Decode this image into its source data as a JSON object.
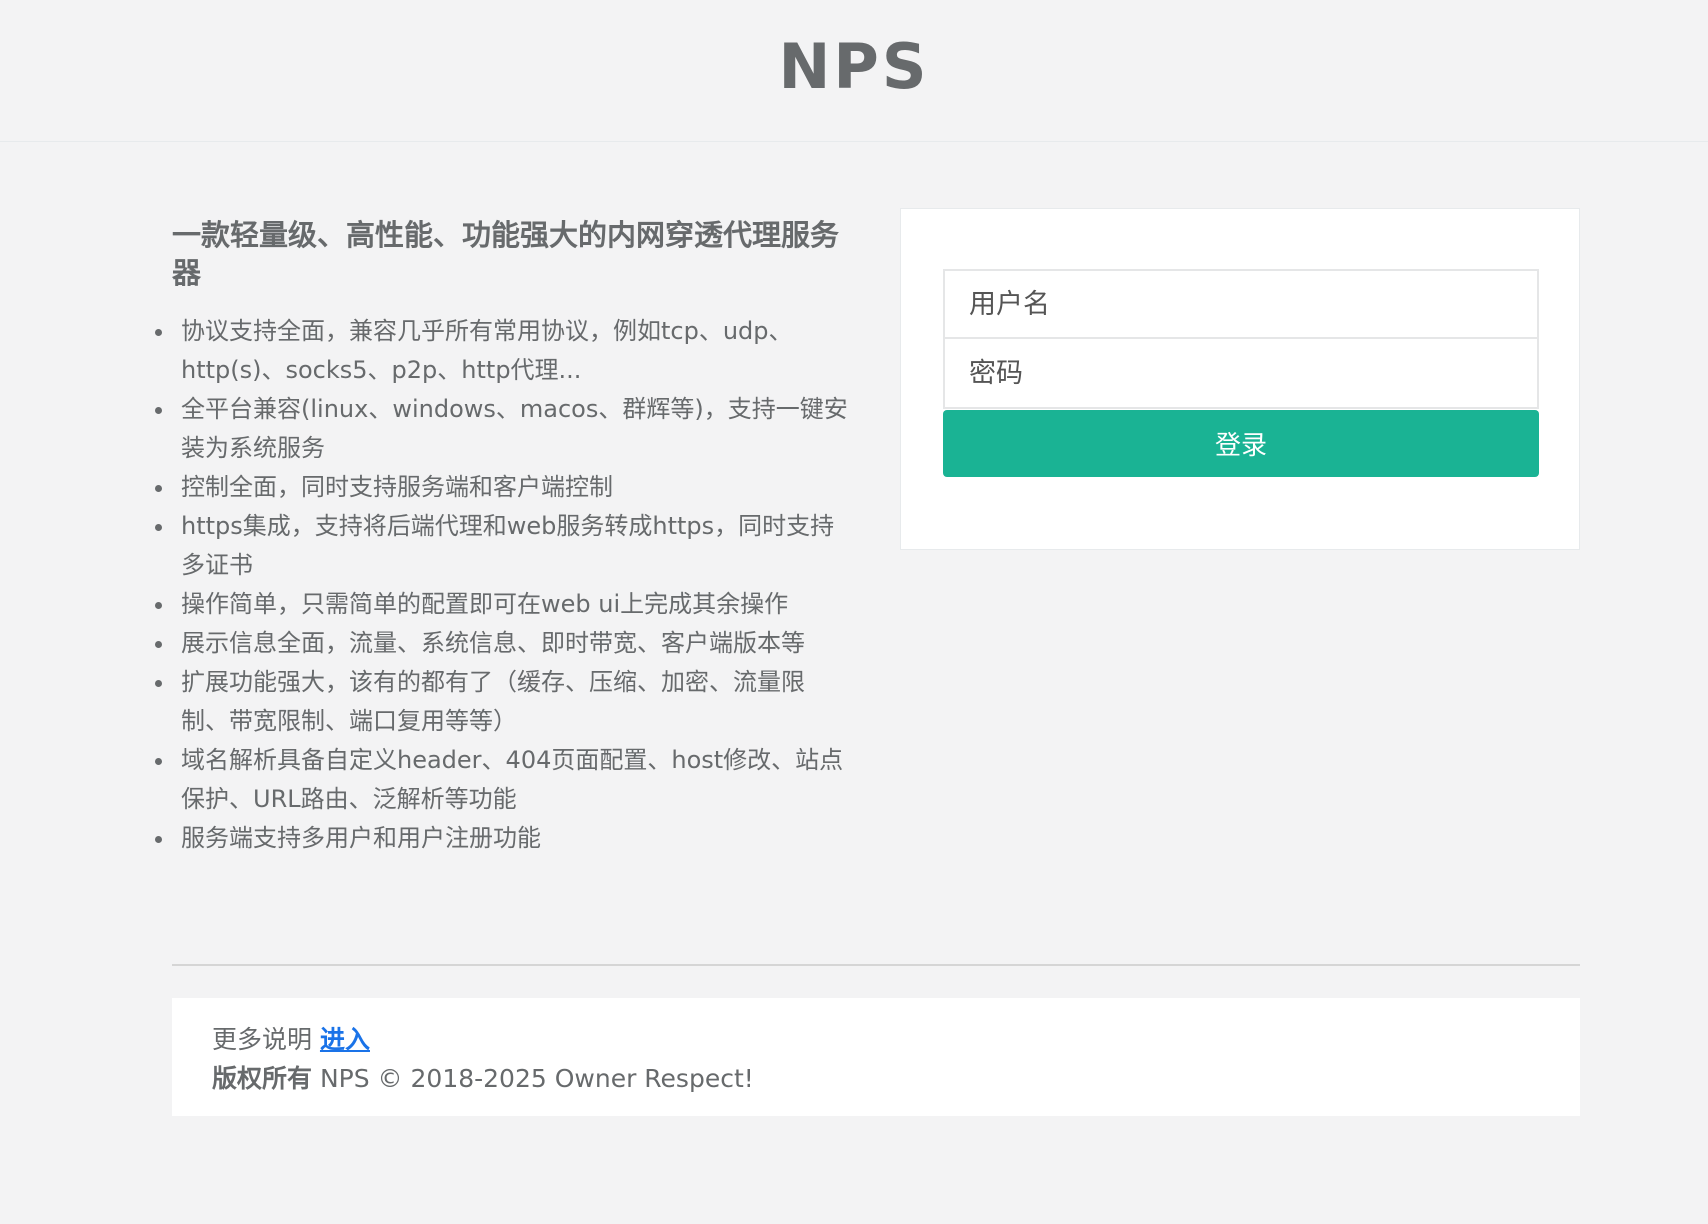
{
  "header": {
    "logo_text": "NPS"
  },
  "info": {
    "title": "一款轻量级、高性能、功能强大的内网穿透代理服务器",
    "features": [
      "协议支持全面，兼容几乎所有常用协议，例如tcp、udp、http(s)、socks5、p2p、http代理...",
      "全平台兼容(linux、windows、macos、群辉等)，支持一键安装为系统服务",
      "控制全面，同时支持服务端和客户端控制",
      "https集成，支持将后端代理和web服务转成https，同时支持多证书",
      "操作简单，只需简单的配置即可在web ui上完成其余操作",
      "展示信息全面，流量、系统信息、即时带宽、客户端版本等",
      "扩展功能强大，该有的都有了（缓存、压缩、加密、流量限制、带宽限制、端口复用等等）",
      "域名解析具备自定义header、404页面配置、host修改、站点保护、URL路由、泛解析等功能",
      "服务端支持多用户和用户注册功能"
    ]
  },
  "login": {
    "username_placeholder": "用户名",
    "username_value": "",
    "password_placeholder": "密码",
    "password_value": "",
    "submit_label": "登录"
  },
  "footer": {
    "more_label": "更多说明",
    "more_link_text": "进入",
    "copyright_label": "版权所有",
    "copyright_text": "NPS © 2018-2025 Owner Respect!"
  },
  "colors": {
    "primary": "#1ab394",
    "link": "#1a73e8",
    "background": "#f3f3f4",
    "text": "#676a6c"
  }
}
